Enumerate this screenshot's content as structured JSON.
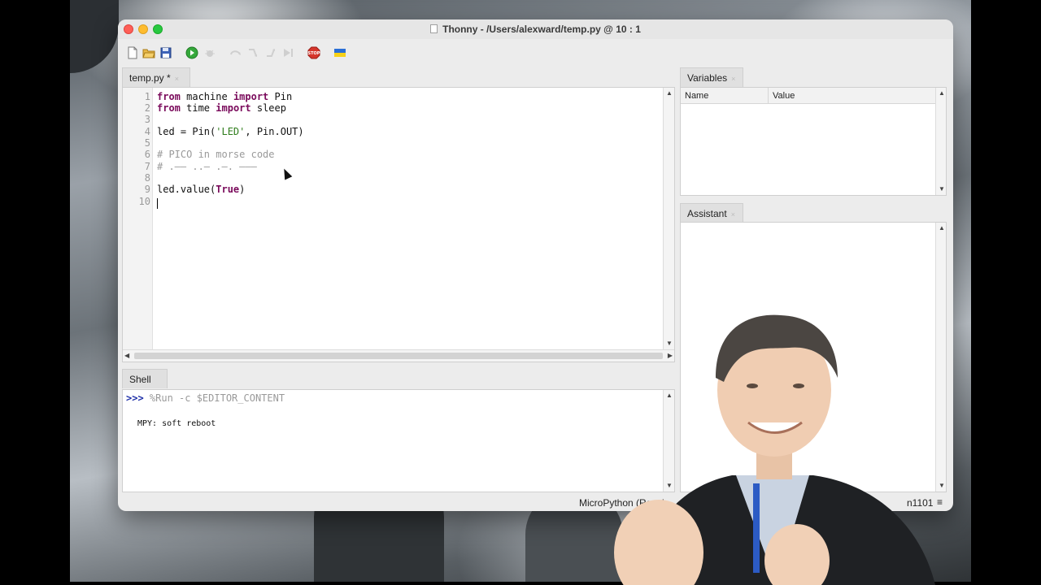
{
  "window": {
    "title": "Thonny  -  /Users/alexward/temp.py  @  10 : 1"
  },
  "toolbar": {
    "icons": [
      "new-file-icon",
      "open-file-icon",
      "save-icon",
      "run-icon",
      "debug-icon",
      "step-over-icon",
      "step-into-icon",
      "step-out-icon",
      "resume-icon",
      "stop-icon",
      "ukraine-flag-icon"
    ],
    "stop_label": "STOP"
  },
  "editor": {
    "tab_label": "temp.py *",
    "tab_close": "×",
    "line_numbers": [
      "1",
      "2",
      "3",
      "4",
      "5",
      "6",
      "7",
      "8",
      "9",
      "10"
    ],
    "lines": {
      "l1_kw1": "from",
      "l1_mid": " machine ",
      "l1_kw2": "import",
      "l1_end": " Pin",
      "l2_kw1": "from",
      "l2_mid": " time ",
      "l2_kw2": "import",
      "l2_end": " sleep",
      "l4_start": "led = Pin(",
      "l4_str": "'LED'",
      "l4_end": ", Pin.OUT)",
      "l6_comment": "# PICO in morse code",
      "l7_comment": "# .—— ..— .—. ———",
      "l9_start": "led.value(",
      "l9_kw": "True",
      "l9_end": ")"
    }
  },
  "shell": {
    "tab_label": "Shell",
    "prompt": ">>>",
    "command": " %Run -c $EDITOR_CONTENT",
    "output": "MPY: soft reboot"
  },
  "variables": {
    "tab_label": "Variables",
    "tab_close": "×",
    "col_name": "Name",
    "col_value": "Value"
  },
  "assistant": {
    "tab_label": "Assistant",
    "tab_close": "×"
  },
  "statusbar": {
    "interpreter": "MicroPython (Raspb",
    "port_fragment": "n1101",
    "menu_icon": "≡"
  }
}
